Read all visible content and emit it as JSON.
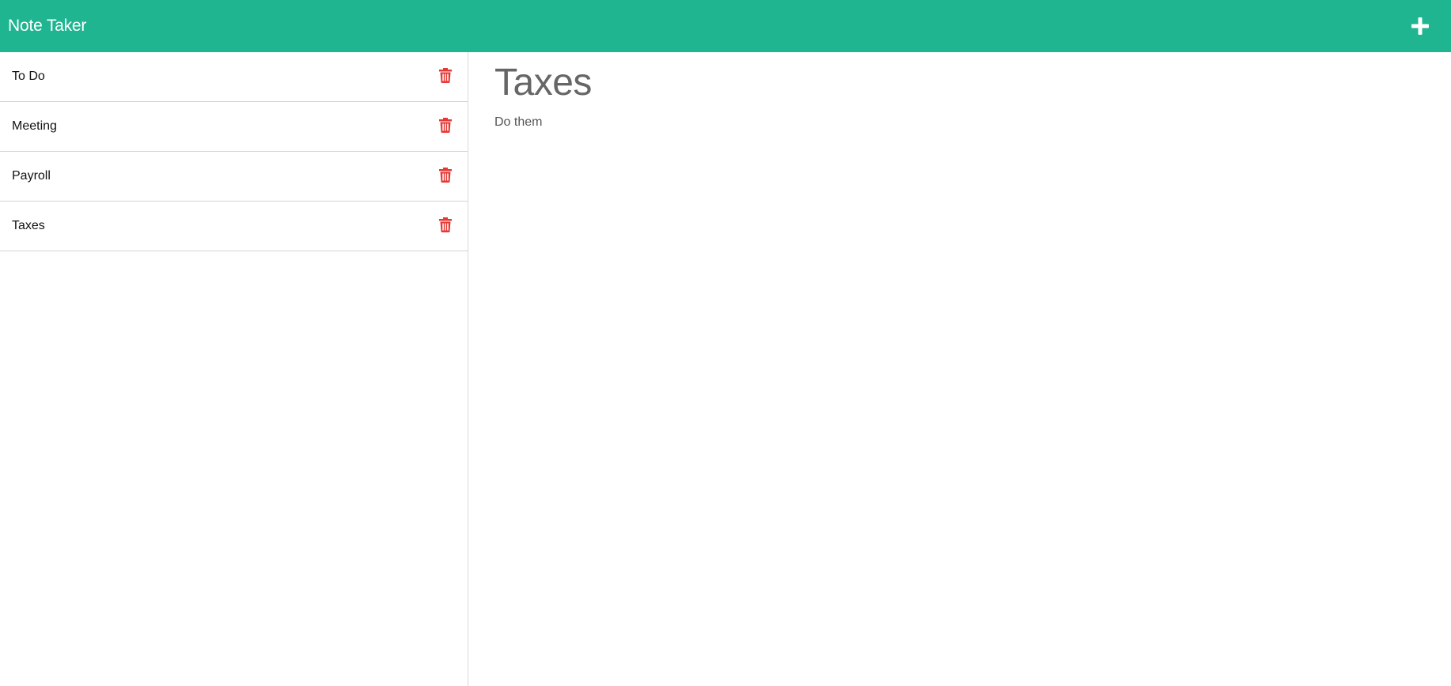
{
  "app": {
    "title": "Note Taker",
    "new_note_icon": "plus-icon"
  },
  "colors": {
    "header_bg": "#1fb591",
    "delete_icon": "#e53935",
    "title_text": "#666666"
  },
  "notes": [
    {
      "title": "To Do",
      "icon": "trash-icon"
    },
    {
      "title": "Meeting",
      "icon": "trash-icon"
    },
    {
      "title": "Payroll",
      "icon": "trash-icon"
    },
    {
      "title": "Taxes",
      "icon": "trash-icon"
    }
  ],
  "active_note": {
    "title": "Taxes",
    "text": "Do them"
  }
}
